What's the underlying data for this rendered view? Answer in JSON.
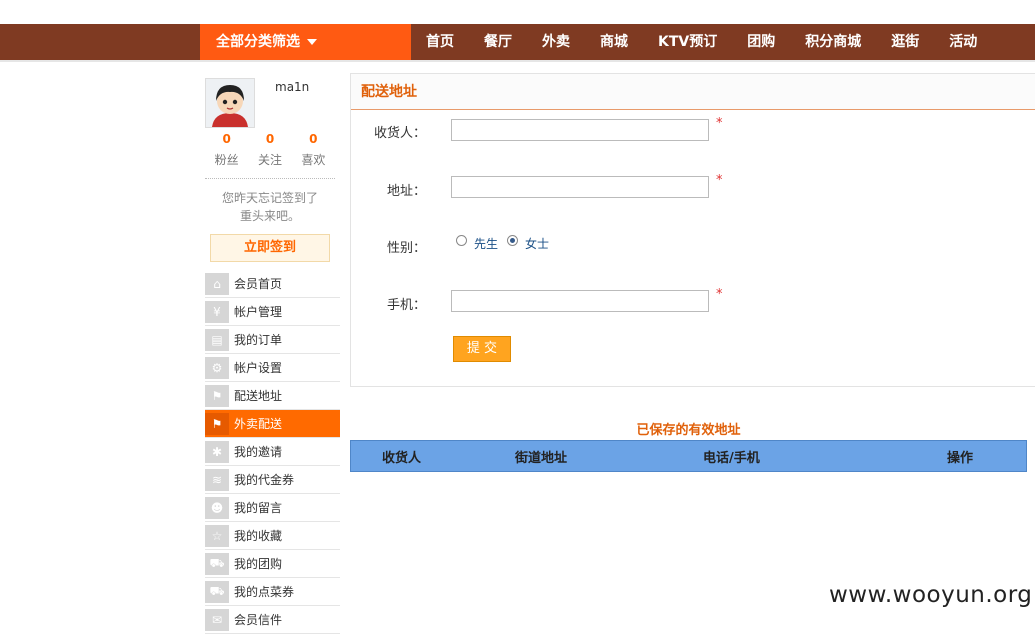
{
  "header": {
    "category_button": "全部分类筛选",
    "nav": [
      "首页",
      "餐厅",
      "外卖",
      "商城",
      "KTV预订",
      "团购",
      "积分商城",
      "逛街",
      "活动"
    ]
  },
  "user": {
    "name": "ma1n",
    "stats": [
      {
        "num": "0",
        "label": "粉丝"
      },
      {
        "num": "0",
        "label": "关注"
      },
      {
        "num": "0",
        "label": "喜欢"
      }
    ],
    "reminder_line1": "您昨天忘记签到了",
    "reminder_line2": "重头来吧。",
    "signin_label": "立即签到"
  },
  "sidebar": {
    "items": [
      {
        "label": "会员首页",
        "icon": "home-icon",
        "glyph": "⌂"
      },
      {
        "label": "帐户管理",
        "icon": "yen-icon",
        "glyph": "¥"
      },
      {
        "label": "我的订单",
        "icon": "document-icon",
        "glyph": "▤"
      },
      {
        "label": "帐户设置",
        "icon": "gear-icon",
        "glyph": "⚙"
      },
      {
        "label": "配送地址",
        "icon": "flag-icon",
        "glyph": "⚑"
      },
      {
        "label": "外卖配送",
        "icon": "flag-icon",
        "glyph": "⚑"
      },
      {
        "label": "我的邀请",
        "icon": "sparkle-icon",
        "glyph": "✱"
      },
      {
        "label": "我的代金券",
        "icon": "layers-icon",
        "glyph": "≋"
      },
      {
        "label": "我的留言",
        "icon": "users-icon",
        "glyph": "☻"
      },
      {
        "label": "我的收藏",
        "icon": "star-icon",
        "glyph": "☆"
      },
      {
        "label": "我的团购",
        "icon": "cart-icon",
        "glyph": "⛟"
      },
      {
        "label": "我的点菜券",
        "icon": "cart-icon",
        "glyph": "⛟"
      },
      {
        "label": "会员信件",
        "icon": "mail-icon",
        "glyph": "✉"
      }
    ],
    "active_index": 5
  },
  "form": {
    "title": "配送地址",
    "receiver_label": "收货人：",
    "receiver_value": "",
    "address_label": "地址：",
    "address_value": "",
    "gender_label": "性别：",
    "gender_options": [
      "先生",
      "女士"
    ],
    "gender_selected": "女士",
    "phone_label": "手机：",
    "phone_value": "",
    "required_mark": "*",
    "submit_label": "提 交"
  },
  "saved": {
    "title": "已保存的有效地址",
    "columns": [
      "收货人",
      "街道地址",
      "电话/手机",
      "操作"
    ]
  },
  "colors": {
    "topbar": "#7f3a22",
    "accent_orange": "#ff5a12",
    "table_header": "#6ba3e6"
  },
  "watermark": "www.wooyun.org"
}
